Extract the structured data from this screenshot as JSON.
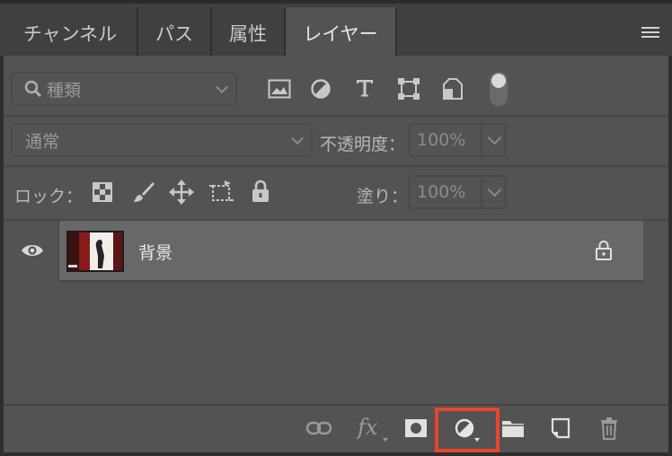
{
  "tabs": [
    {
      "label": "チャンネル",
      "active": false
    },
    {
      "label": "パス",
      "active": false
    },
    {
      "label": "属性",
      "active": false
    },
    {
      "label": "レイヤー",
      "active": true
    }
  ],
  "filter": {
    "label": "種類",
    "icons": [
      "image-filter-icon",
      "adjustment-filter-icon",
      "type-filter-icon",
      "shape-filter-icon",
      "smart-object-filter-icon"
    ]
  },
  "blend": {
    "mode": "通常",
    "opacity_label": "不透明度：",
    "opacity_value": "100%"
  },
  "lock": {
    "label": "ロック：",
    "fill_label": "塗り：",
    "fill_value": "100%"
  },
  "layers": [
    {
      "name": "背景",
      "visible": true,
      "locked": true
    }
  ],
  "bottom_bar": {
    "fx_label": "fx"
  },
  "colors": {
    "highlight": "#e8452c",
    "panel": "#535353",
    "selected_layer": "#686868"
  }
}
